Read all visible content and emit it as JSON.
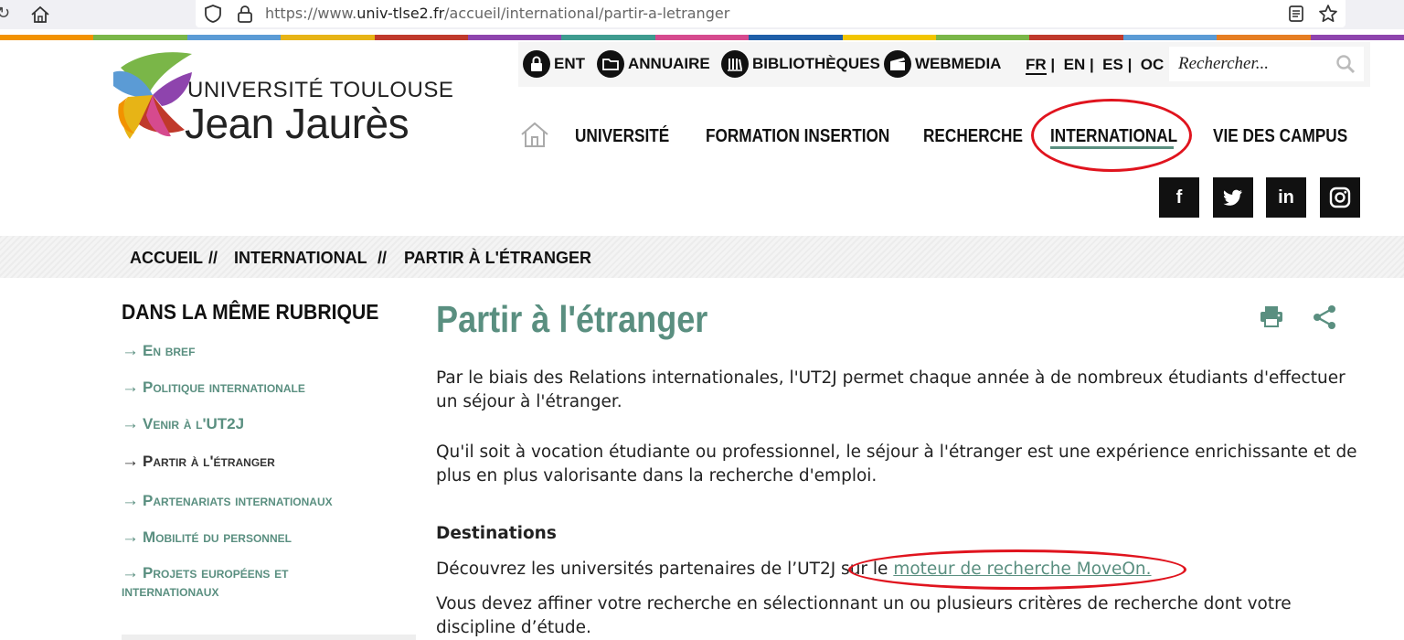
{
  "browser": {
    "url_prefix": "https://www.",
    "url_domain": "univ-tlse2.fr",
    "url_path": "/accueil/international/partir-a-letranger"
  },
  "colors": {
    "accent": "#5a8f80",
    "highlight": "#e0141e",
    "strip": [
      "#f29200",
      "#7ab648",
      "#5b9bd5",
      "#e7b416",
      "#c0392b",
      "#8e44ad",
      "#3e9b8f",
      "#d64a8e",
      "#1f5fa8",
      "#f2c500",
      "#7ab648",
      "#c0392b",
      "#5b9bd5",
      "#e67e22",
      "#8e44ad"
    ]
  },
  "logo": {
    "line1": "UNIVERSITÉ TOULOUSE",
    "line2": "Jean Jaurès"
  },
  "utility": {
    "links": [
      {
        "label": "ENT",
        "icon": "lock-icon"
      },
      {
        "label": "ANNUAIRE",
        "icon": "folder-icon"
      },
      {
        "label": "BIBLIOTHÈQUES",
        "icon": "library-icon"
      },
      {
        "label": "WEBMEDIA",
        "icon": "clapperboard-icon"
      }
    ],
    "languages": [
      "FR",
      "EN",
      "ES",
      "OC"
    ],
    "search_placeholder": "Rechercher..."
  },
  "nav": {
    "items": [
      "UNIVERSITÉ",
      "FORMATION INSERTION",
      "RECHERCHE",
      "INTERNATIONAL",
      "VIE DES CAMPUS"
    ],
    "active": "INTERNATIONAL"
  },
  "social": [
    "f",
    "twitter",
    "in",
    "instagram"
  ],
  "breadcrumb": {
    "items": [
      "ACCUEIL",
      "INTERNATIONAL",
      "PARTIR À L'ÉTRANGER"
    ],
    "separator": "//"
  },
  "sidebar": {
    "title": "DANS LA MÊME RUBRIQUE",
    "items": [
      {
        "label": "En bref"
      },
      {
        "label": "Politique internationale"
      },
      {
        "label": "Venir à l'UT2J"
      },
      {
        "label": "Partir à l'étranger"
      },
      {
        "label": "Partenariats internationaux"
      },
      {
        "label": "Mobilité du personnel"
      },
      {
        "label": "Projets européens et internationaux"
      }
    ]
  },
  "main": {
    "title": "Partir à l'étranger",
    "para1": "Par le biais des Relations internationales, l'UT2J permet chaque année à de nombreux étudiants d'effectuer un séjour à l'étranger.",
    "para2": "Qu'il soit à vocation étudiante ou professionnel, le séjour à l'étranger est une expérience enrichissante et de plus en plus valorisante dans la recherche d'emploi.",
    "section_title": "Destinations",
    "para3_before": "Découvrez les universités partenaires de l’UT2J sur le ",
    "para3_link": "moteur de recherche MoveOn.",
    "para4": "Vous devez affiner votre recherche en sélectionnant un ou plusieurs critères de recherche dont votre discipline d’étude."
  }
}
